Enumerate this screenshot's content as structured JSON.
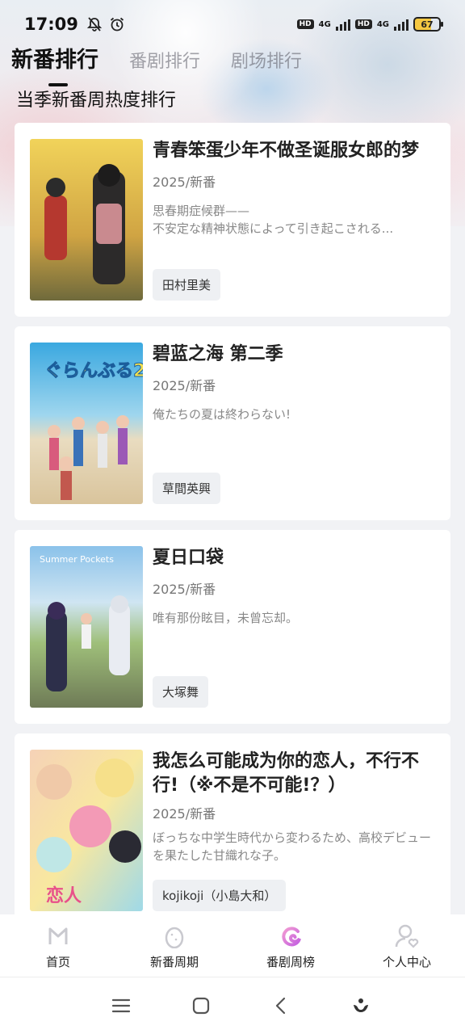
{
  "status_bar": {
    "time": "17:09",
    "net1": "4G",
    "net2": "4G",
    "hd": "HD",
    "battery": "67"
  },
  "tabs": [
    {
      "label": "新番排行",
      "active": true
    },
    {
      "label": "番剧排行",
      "active": false
    },
    {
      "label": "剧场排行",
      "active": false
    }
  ],
  "section_title": "当季新番周热度排行",
  "items": [
    {
      "title": "青春笨蛋少年不做圣诞服女郎的梦",
      "meta": "2025/新番",
      "desc": "思春期症候群——\n不安定な精神状態によって引き起こされる...",
      "tag": "田村里美",
      "poster_colors": [
        "#e9c44d",
        "#c9a24a",
        "#6b6f3a"
      ]
    },
    {
      "title": "碧蓝之海 第二季",
      "meta": "2025/新番",
      "desc": "俺たちの夏は終わらない!",
      "tag": "草間英興",
      "poster_colors": [
        "#4fb7e6",
        "#a9dcef",
        "#e7d6b5"
      ]
    },
    {
      "title": "夏日口袋",
      "meta": "2025/新番",
      "desc": "唯有那份眩目，未曾忘却。",
      "tag": "大塚舞",
      "poster_colors": [
        "#7fb9e3",
        "#b5d08f",
        "#7b8a64"
      ]
    },
    {
      "title": "我怎么可能成为你的恋人，不行不行!（※不是不可能!？）",
      "meta": "2025/新番",
      "desc": "ぼっちな中学生時代から変わるため、高校デビューを果たした甘織れな子。",
      "tag": "kojikoji（小島大和）",
      "poster_colors": [
        "#f6b0c4",
        "#f8e08a",
        "#9fd9e8"
      ]
    }
  ],
  "bottom_nav": [
    {
      "label": "首页",
      "icon": "home-m-icon",
      "active": false
    },
    {
      "label": "新番周期",
      "icon": "egg-icon",
      "active": false
    },
    {
      "label": "番剧周榜",
      "icon": "swirl-icon",
      "active": true
    },
    {
      "label": "个人中心",
      "icon": "user-heart-icon",
      "active": false
    }
  ],
  "system_nav": [
    "menu-icon",
    "home-square-icon",
    "back-icon",
    "assistant-icon"
  ],
  "colors": {
    "accent": "#d868d8",
    "background": "#f1f2f5",
    "card": "#ffffff",
    "tag_bg": "#eef0f3"
  }
}
